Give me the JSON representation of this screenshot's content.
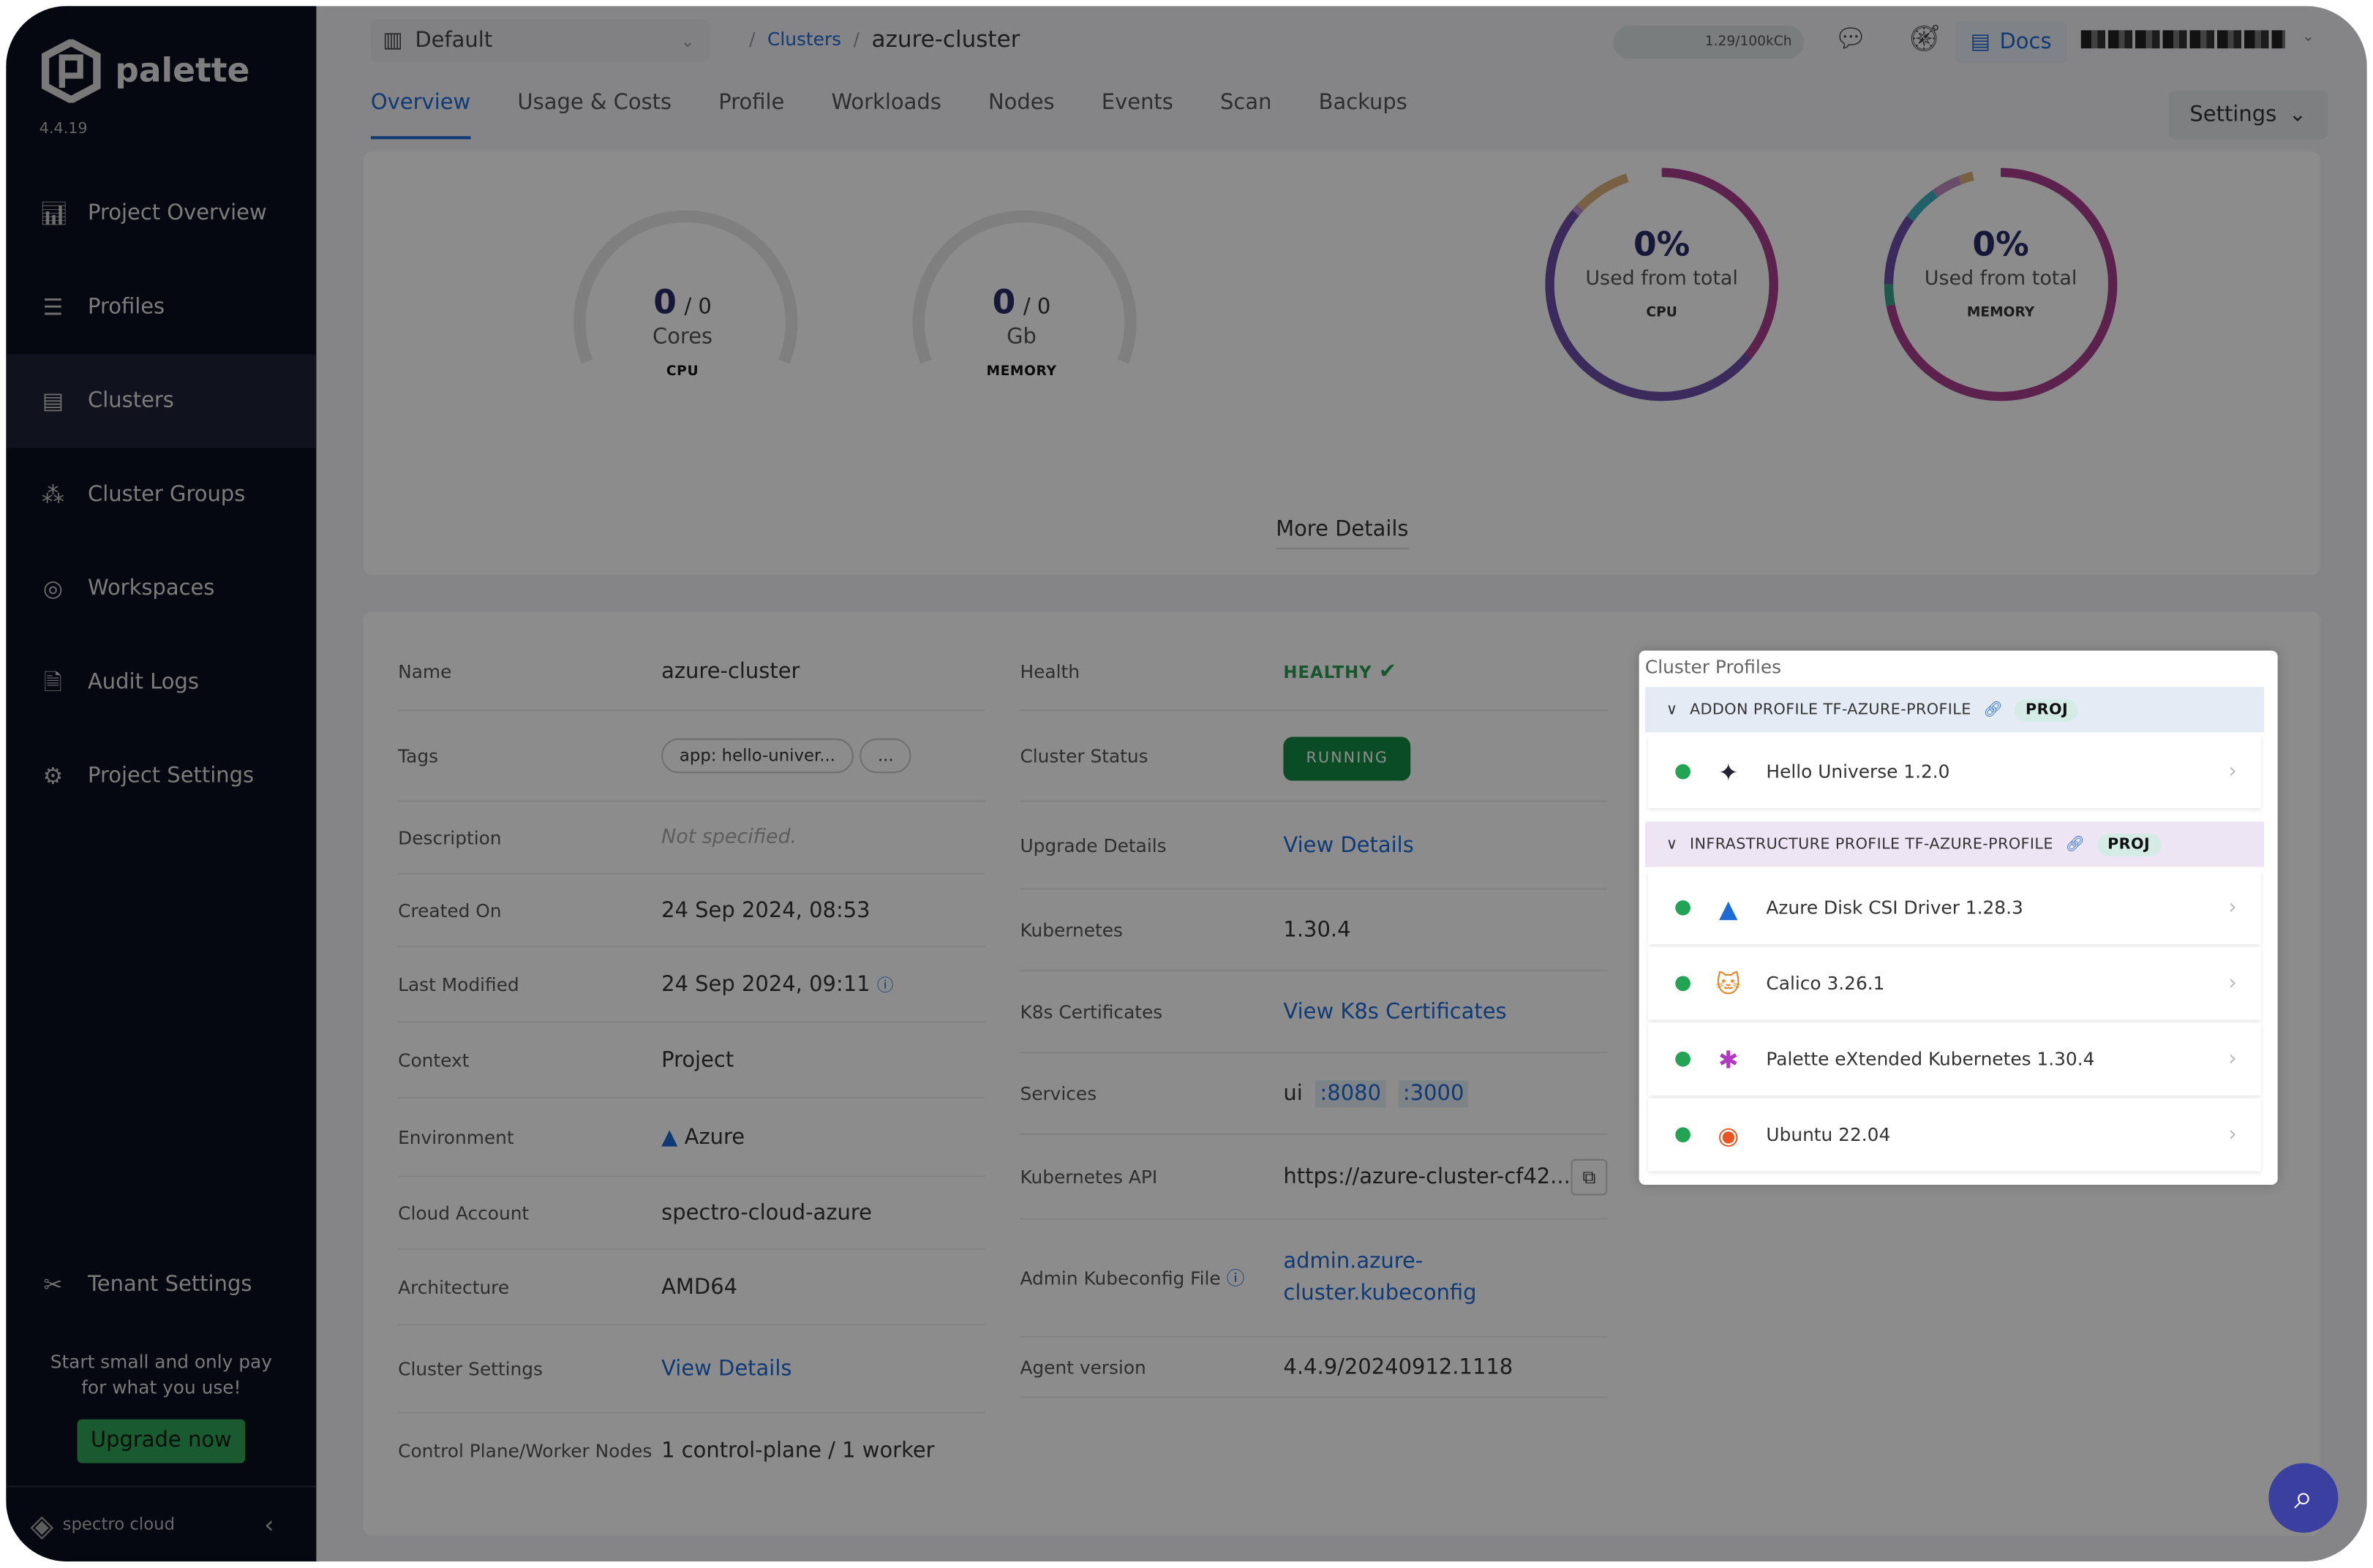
{
  "app": {
    "name": "palette",
    "version": "4.4.19"
  },
  "sidebar": {
    "items": [
      {
        "label": "Project Overview",
        "icon": "chart-icon"
      },
      {
        "label": "Profiles",
        "icon": "layers-icon"
      },
      {
        "label": "Clusters",
        "icon": "clusters-icon",
        "active": true
      },
      {
        "label": "Cluster Groups",
        "icon": "cluster-groups-icon"
      },
      {
        "label": "Workspaces",
        "icon": "workspaces-icon"
      },
      {
        "label": "Audit Logs",
        "icon": "audit-icon"
      },
      {
        "label": "Project Settings",
        "icon": "gear-icon"
      }
    ],
    "tenant_settings": "Tenant Settings",
    "promo_line1": "Start small and only pay",
    "promo_line2": "for what you use!",
    "upgrade_label": "Upgrade now",
    "footer_brand": "spectro cloud"
  },
  "header": {
    "project": "Default",
    "breadcrumb_parent": "Clusters",
    "breadcrumb_current": "azure-cluster",
    "usage": "1.29/100kCh",
    "docs_label": "Docs"
  },
  "tabs": [
    "Overview",
    "Usage & Costs",
    "Profile",
    "Workloads",
    "Nodes",
    "Events",
    "Scan",
    "Backups"
  ],
  "active_tab": "Overview",
  "settings_label": "Settings",
  "resources": {
    "cpu_gauge": {
      "used": "0",
      "total": "/ 0",
      "unit": "Cores",
      "caption": "CPU"
    },
    "memory_gauge": {
      "used": "0",
      "total": "/ 0",
      "unit": "Gb",
      "caption": "MEMORY"
    },
    "cpu_donut": {
      "percent": "0%",
      "subtitle": "Used from total",
      "caption": "CPU",
      "segments": [
        {
          "fraction": 0.36,
          "color": "#a83c8c"
        },
        {
          "fraction": 0.5,
          "color": "#6b4fa8"
        },
        {
          "fraction": 0.01,
          "color": "#b58bd0"
        },
        {
          "fraction": 0.08,
          "color": "#d9b07a"
        }
      ]
    },
    "memory_donut": {
      "percent": "0%",
      "subtitle": "Used from total",
      "caption": "MEMORY",
      "segments": [
        {
          "fraction": 0.72,
          "color": "#a83c8c"
        },
        {
          "fraction": 0.03,
          "color": "#3aa38a"
        },
        {
          "fraction": 0.1,
          "color": "#6b4fa8"
        },
        {
          "fraction": 0.05,
          "color": "#3fb0c0"
        },
        {
          "fraction": 0.04,
          "color": "#c08ac0"
        },
        {
          "fraction": 0.02,
          "color": "#d9b07a"
        }
      ]
    },
    "more_details": "More Details"
  },
  "details_left": {
    "name_label": "Name",
    "name": "azure-cluster",
    "tags_label": "Tags",
    "tag": "app: hello-univer...",
    "tag_more": "...",
    "description_label": "Description",
    "description": "Not specified.",
    "created_label": "Created On",
    "created": "24 Sep 2024, 08:53",
    "modified_label": "Last Modified",
    "modified": "24 Sep 2024, 09:11",
    "context_label": "Context",
    "context": "Project",
    "environment_label": "Environment",
    "environment": "Azure",
    "cloud_account_label": "Cloud Account",
    "cloud_account": "spectro-cloud-azure",
    "architecture_label": "Architecture",
    "architecture": "AMD64",
    "cluster_settings_label": "Cluster Settings",
    "cluster_settings": "View Details",
    "nodes_label": "Control Plane/Worker Nodes",
    "nodes": "1 control-plane / 1 worker"
  },
  "details_right": {
    "health_label": "Health",
    "health": "HEALTHY",
    "status_label": "Cluster Status",
    "status": "RUNNING",
    "upgrade_label": "Upgrade Details",
    "upgrade": "View Details",
    "k8s_label": "Kubernetes",
    "k8s": "1.30.4",
    "certs_label": "K8s Certificates",
    "certs": "View K8s Certificates",
    "services_label": "Services",
    "service_name": "ui",
    "port1": ":8080",
    "port2": ":3000",
    "api_label": "Kubernetes API",
    "api": "https://azure-cluster-cf42...",
    "kubeconfig_label": "Admin Kubeconfig File",
    "kubeconfig_line1": "admin.azure-",
    "kubeconfig_line2": "cluster.kubeconfig",
    "agent_label": "Agent version",
    "agent": "4.4.9/20240912.1118"
  },
  "cluster_profiles": {
    "title": "Cluster Profiles",
    "addon": {
      "header": "ADDON PROFILE TF-AZURE-PROFILE",
      "badge": "PROJ",
      "packs": [
        {
          "name": "Hello Universe 1.2.0",
          "icon": "hello-universe-icon"
        }
      ]
    },
    "infra": {
      "header": "INFRASTRUCTURE PROFILE TF-AZURE-PROFILE",
      "badge": "PROJ",
      "packs": [
        {
          "name": "Azure Disk CSI Driver 1.28.3",
          "icon": "azure-icon"
        },
        {
          "name": "Calico 3.26.1",
          "icon": "calico-icon"
        },
        {
          "name": "Palette eXtended Kubernetes 1.30.4",
          "icon": "kubernetes-icon"
        },
        {
          "name": "Ubuntu 22.04",
          "icon": "ubuntu-icon"
        }
      ]
    },
    "status_color": "#23a455"
  }
}
